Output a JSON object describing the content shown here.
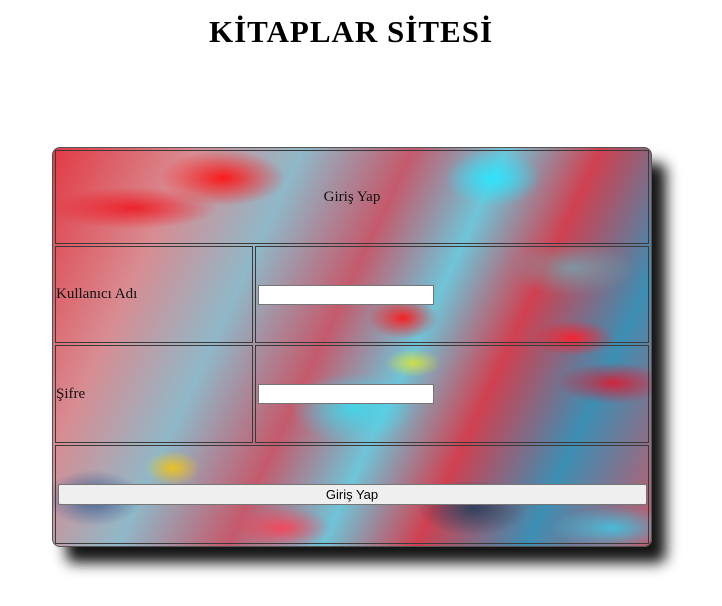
{
  "header": {
    "title": "KİTAPLAR SİTESİ"
  },
  "login_form": {
    "heading": "Giriş Yap",
    "username": {
      "label": "Kullanıcı Adı",
      "value": "",
      "placeholder": ""
    },
    "password": {
      "label": "Şifre",
      "value": "",
      "placeholder": ""
    },
    "submit_label": "Giriş Yap"
  }
}
